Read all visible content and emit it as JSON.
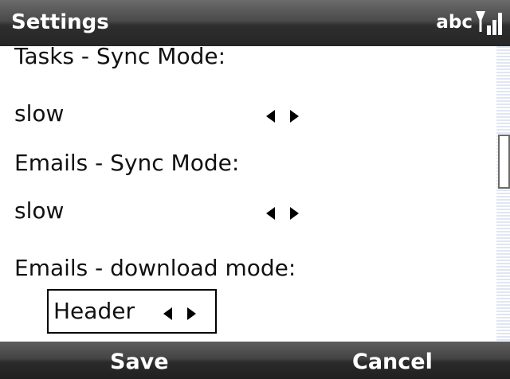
{
  "title_bar": {
    "title": "Settings",
    "input_mode": "abc",
    "signal_icon": "signal-strength-icon"
  },
  "settings": {
    "tasks_sync_label": "Tasks - Sync Mode:",
    "tasks_sync_value": "slow",
    "emails_sync_label": "Emails - Sync Mode:",
    "emails_sync_value": "slow",
    "emails_download_label": "Emails - download mode:",
    "emails_download_value": "Header"
  },
  "softkeys": {
    "left": "Save",
    "right": "Cancel"
  },
  "colors": {
    "bar_dark": "#2e2e2e",
    "text": "#111111",
    "scroll_track": "#dfe6f3"
  }
}
